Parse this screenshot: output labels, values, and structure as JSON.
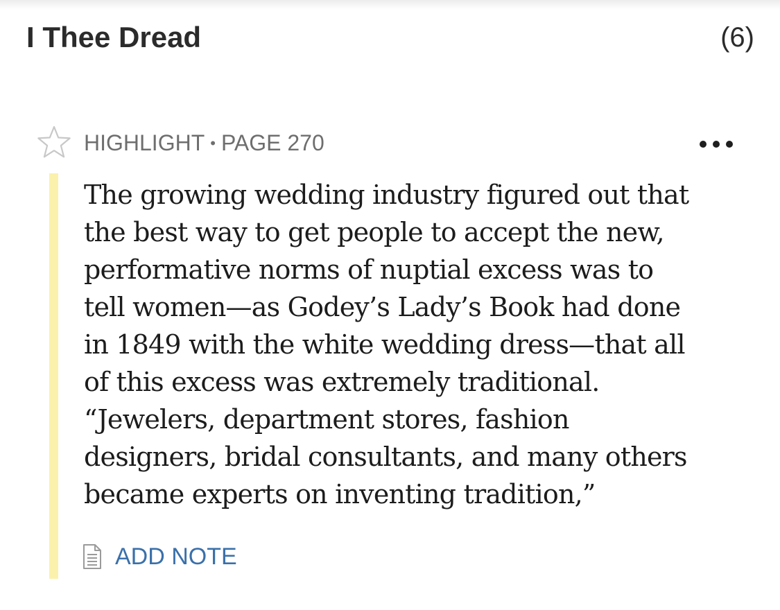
{
  "header": {
    "book_title": "I Thee Dread",
    "highlight_count": "(6)"
  },
  "highlight": {
    "star_icon": "star-outline-icon",
    "type_label": "HIGHLIGHT",
    "separator": "•",
    "page_label": "PAGE 270",
    "more_icon": "more-horizontal-icon",
    "highlight_color": "#fbf1ad",
    "text": "The growing wedding industry figured out that\nthe best way to get people to accept the new,\nperformative norms of nuptial excess was to\ntell women—as Godey’s Lady’s Book had done\nin 1849 with the white wedding dress—that all\nof this excess was extremely traditional.\n“Jewelers, department stores, fashion\ndesigners, bridal consultants, and many others\nbecame experts on inventing tradition,”",
    "note_icon": "note-document-icon",
    "add_note_label": "ADD NOTE",
    "add_note_color": "#3a70aa"
  }
}
